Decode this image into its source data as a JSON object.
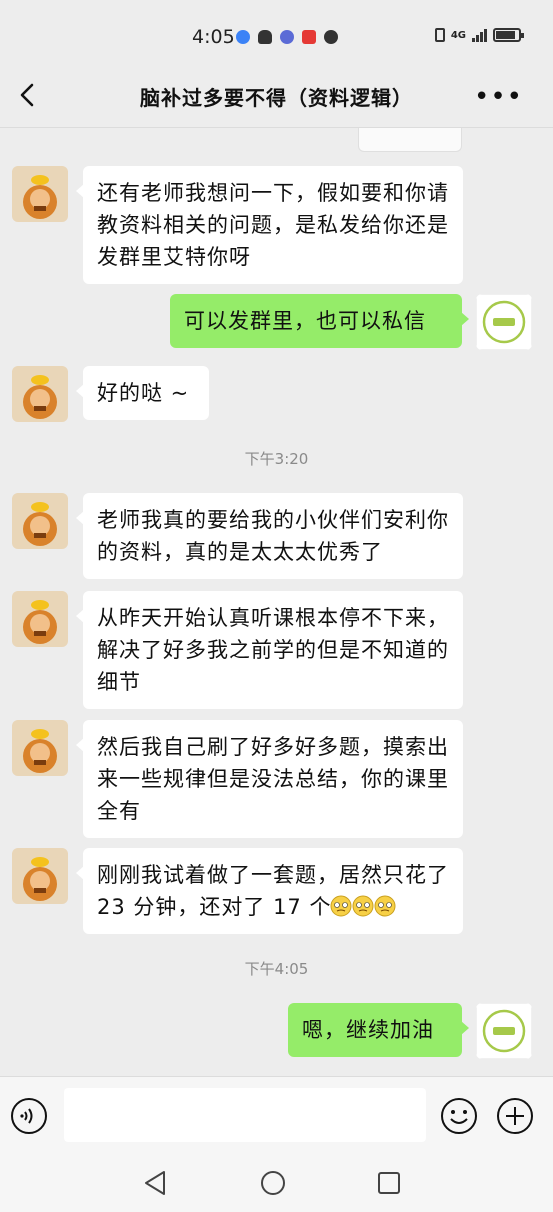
{
  "status_bar": {
    "time": "4:05",
    "network": "4G"
  },
  "header": {
    "title": "脑补过多要不得（资料逻辑）",
    "back_icon": "chevron-left-icon",
    "more_icon": "more-dots-icon"
  },
  "messages": [
    {
      "direction": "in",
      "text": "还有老师我想问一下，假如要和你请教资料相关的问题，是私发给你还是发群里艾特你呀"
    },
    {
      "direction": "out",
      "text": "可以发群里，也可以私信"
    },
    {
      "direction": "in",
      "text": "好的哒 ~"
    },
    {
      "type": "time",
      "text": "下午3:20"
    },
    {
      "direction": "in",
      "text": "老师我真的要给我的小伙伴们安利你的资料，真的是太太太优秀了"
    },
    {
      "direction": "in",
      "text": "从昨天开始认真听课根本停不下来，解决了好多我之前学的但是不知道的细节"
    },
    {
      "direction": "in",
      "text": "然后我自己刷了好多好多题，摸索出来一些规律但是没法总结，你的课里全有"
    },
    {
      "direction": "in",
      "text": "刚刚我试着做了一套题，居然只花了 23 分钟，还对了 17 个"
    },
    {
      "type": "time",
      "text": "下午4:05"
    },
    {
      "direction": "out",
      "text": "嗯，继续加油"
    }
  ],
  "input_bar": {
    "voice_icon": "voice-icon",
    "emoji_icon": "smiley-icon",
    "plus_icon": "plus-circle-icon"
  },
  "colors": {
    "background": "#ededed",
    "bubble_out": "#95ec69",
    "bubble_in": "#ffffff"
  }
}
